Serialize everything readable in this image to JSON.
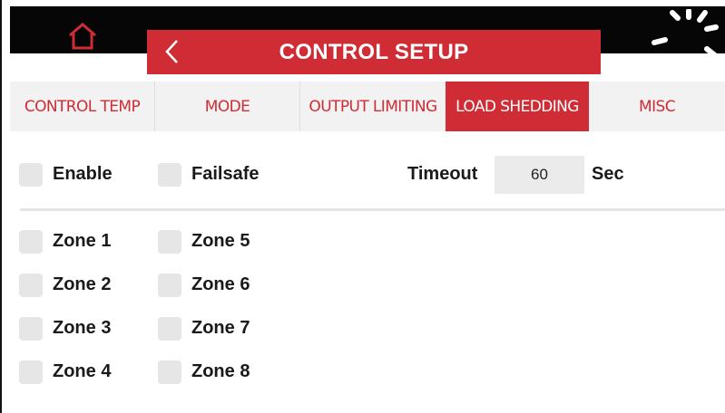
{
  "header": {
    "title": "CONTROL SETUP"
  },
  "tabs": [
    {
      "label": "CONTROL TEMP"
    },
    {
      "label": "MODE"
    },
    {
      "label": "OUTPUT LIMITING"
    },
    {
      "label": "LOAD SHEDDING"
    },
    {
      "label": "MISC"
    }
  ],
  "active_tab": "LOAD SHEDDING",
  "options": {
    "enable_label": "Enable",
    "failsafe_label": "Failsafe",
    "timeout_label": "Timeout",
    "timeout_value": "60",
    "timeout_unit": "Sec"
  },
  "zones": [
    {
      "label": "Zone 1"
    },
    {
      "label": "Zone 2"
    },
    {
      "label": "Zone 3"
    },
    {
      "label": "Zone 4"
    },
    {
      "label": "Zone 5"
    },
    {
      "label": "Zone 6"
    },
    {
      "label": "Zone 7"
    },
    {
      "label": "Zone 8"
    }
  ],
  "colors": {
    "accent": "#cf2c35",
    "topbar": "#060606",
    "tab_bg": "#f2f2f2",
    "checkbox": "#e6e6e6"
  },
  "icons": [
    "home-icon",
    "back-arrow-icon",
    "loading-spinner-icon"
  ]
}
